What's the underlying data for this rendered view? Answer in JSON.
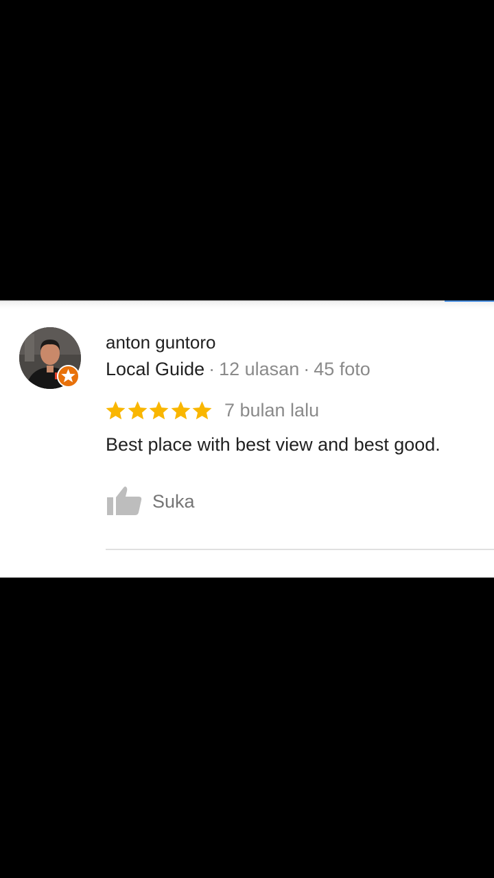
{
  "review": {
    "reviewer_name": "anton guntoro",
    "guide_label": "Local Guide",
    "separator": "·",
    "review_count": "12 ulasan",
    "photo_count": "45 foto",
    "rating": 5,
    "rating_max": 5,
    "date": "7 bulan lalu",
    "text": "Best place with best view and best good.",
    "like_label": "Suka"
  },
  "icons": {
    "avatar": "avatar-photo",
    "badge": "local-guide-star-badge",
    "star": "star-icon",
    "like": "thumbs-up-icon"
  },
  "colors": {
    "star": "#f9b600",
    "badge": "#e8710a",
    "primary_text": "#212121",
    "secondary_text": "#8a8a8a",
    "like_icon": "#bdbdbd",
    "accent": "#4a90e2"
  }
}
